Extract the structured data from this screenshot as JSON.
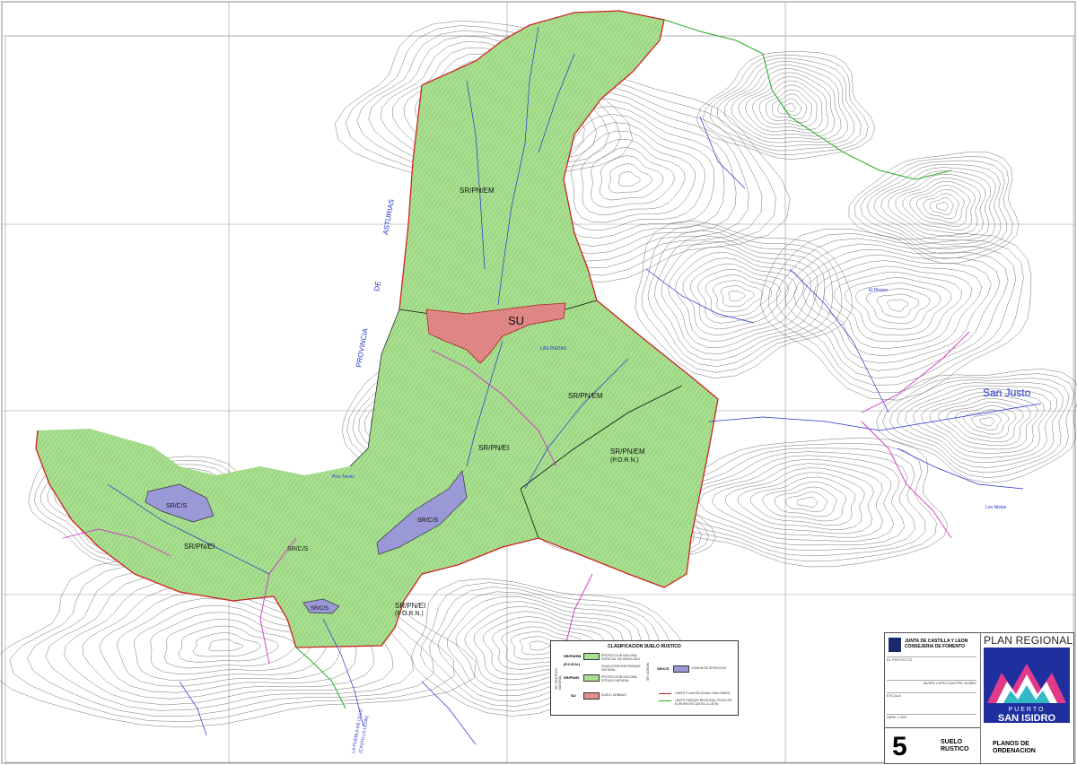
{
  "colors": {
    "green_zone": "#a8e08f",
    "pink_zone": "#e58c8c",
    "purple_zone": "#9b98d8",
    "contour": "#333333",
    "boundary_red": "#cc2222",
    "water_blue": "#2233cc",
    "path_magenta": "#d033c0",
    "limit_green": "#22aa22"
  },
  "zones": {
    "sr_pn_em_north": "SR/PN/EM",
    "su": "SU",
    "sr_pn_em_center": "SR/PN/EM",
    "sr_pn_ei_center": "SR/PN/EI",
    "sr_pn_em_porn_line1": "SR/PN/EM",
    "sr_pn_em_porn_line2": "(P.O.R.N.)",
    "sr_c_s_west": "SR/C/S",
    "sr_pn_ei_west": "SR/PN/EI",
    "sr_c_s_mid": "SR/C/S",
    "sr_c_s_south_mid": "SR/C/S",
    "sr_c_s_south": "SR/C/S",
    "sr_pn_ei_porn_line1": "SR/PN/EI",
    "sr_pn_ei_porn_line2": "(P.O.R.N.)"
  },
  "place_names": {
    "provincia": "PROVINCIA",
    "de": "DE",
    "asturias": "ASTURIAS",
    "san_justo": "San Justo",
    "el_pinzon": "El Pinzon",
    "las_piedas": "LAS PIEDAS",
    "pico_torres": "Pico Torres",
    "los_nistas": "Los Nistas",
    "provincia_south_line1": "LA PUEBLA DE LILLO",
    "provincia_south_line2": "(CASTILLA-LEON)"
  },
  "legend": {
    "title": "CLASIFICACION SUELO RUSTICO",
    "side1": "SR: PROTECC. NATURAL",
    "side2": "SR: COMUN",
    "row1_code": "SR/PN/EM",
    "row1_sub": "(P.O.R.N.)",
    "row1_text1": "PROTECCION NATURAL ESPECIAL DE ARBOLADO",
    "row1_text2": "ZONA ATENCION PARQUE NATURAL",
    "row2_code": "SR/PN/EI",
    "row2_text": "PROTECCION NATURAL ESTADO NATURAL",
    "row3_code": "SR/C/S",
    "row3_text": "COMUN DE SERVICIOS",
    "row4_code": "SU",
    "row4_text": "SUELO URBANO",
    "line1_text": "LIMITE PLAN REGIONAL SAN ISIDRO",
    "line2_text": "LIMITE PARQUE REGIONAL PICOS DE EUROPA EN CASTILLA-LEON"
  },
  "titleblock": {
    "junta_line1": "JUNTA DE CASTILLA Y LEON",
    "junta_line2": "CONSEJERIA DE FOMENTO",
    "row_proyecto": "EL PROYECTO",
    "row_autor": "JAVIER LOPEZ-SASTRE NUÑEZ",
    "row_escala": "ESCALA",
    "row_fecha": "ABRIL 2.003",
    "sheet_number": "5",
    "sheet_title_line1": "SUELO",
    "sheet_title_line2": "RUSTICO",
    "plan_regional": "PLAN REGIONAL",
    "puerto": "PUERTO",
    "san_isidro": "SAN ISIDRO",
    "planos_line1": "PLANOS DE",
    "planos_line2": "ORDENACION"
  }
}
